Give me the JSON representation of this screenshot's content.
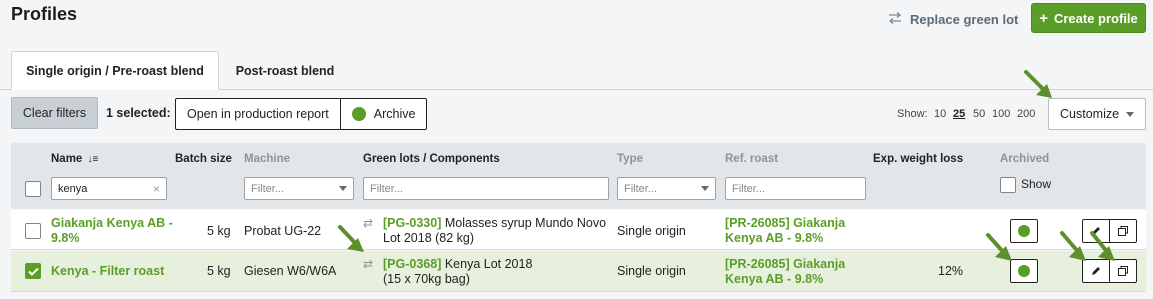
{
  "header": {
    "title": "Profiles",
    "replace_label": "Replace green lot",
    "create_label": "Create profile"
  },
  "tabs": [
    {
      "label": "Single origin / Pre-roast blend",
      "active": true
    },
    {
      "label": "Post-roast blend",
      "active": false
    }
  ],
  "toolbar": {
    "clear_filters": "Clear filters",
    "selected_count": "1 selected:",
    "open_report": "Open in production report",
    "archive": "Archive",
    "show_label": "Show:",
    "page_sizes": [
      "10",
      "25",
      "50",
      "100",
      "200"
    ],
    "page_size_selected": "25",
    "customize": "Customize"
  },
  "table": {
    "columns": {
      "name": "Name",
      "batch_size": "Batch size",
      "machine": "Machine",
      "green_lots": "Green lots / Components",
      "type": "Type",
      "ref_roast": "Ref. roast",
      "weight_loss": "Exp. weight loss",
      "archived": "Archived"
    },
    "filters": {
      "name_value": "kenya",
      "machine_placeholder": "Filter...",
      "green_placeholder": "Filter...",
      "type_placeholder": "Filter...",
      "ref_placeholder": "Filter...",
      "archived_show": "Show"
    },
    "rows": [
      {
        "name_line1": "Giakanja Kenya AB -",
        "name_line2": "9.8%",
        "batch": "5 kg",
        "machine": "Probat UG-22",
        "lot_code": "[PG-0330]",
        "lot_text1": "Molasses syrup Mundo Novo",
        "lot_text2": "Lot 2018 (82 kg)",
        "type": "Single origin",
        "ref_line1": "[PR-26085] Giakanja",
        "ref_line2": "Kenya AB - 9.8%",
        "weight_loss": "",
        "selected": false
      },
      {
        "name_line1": "Kenya - Filter roast",
        "name_line2": "",
        "batch": "5 kg",
        "machine": "Giesen W6/W6A",
        "lot_code": "[PG-0368]",
        "lot_text1": "Kenya Lot 2018",
        "lot_text2": "(15 x 70kg bag)",
        "type": "Single origin",
        "ref_line1": "[PR-26085] Giakanja",
        "ref_line2": "Kenya AB - 9.8%",
        "weight_loss": "12%",
        "selected": true
      }
    ]
  },
  "colors": {
    "accent": "#5a9e27",
    "arrow": "#5f8f2c"
  }
}
